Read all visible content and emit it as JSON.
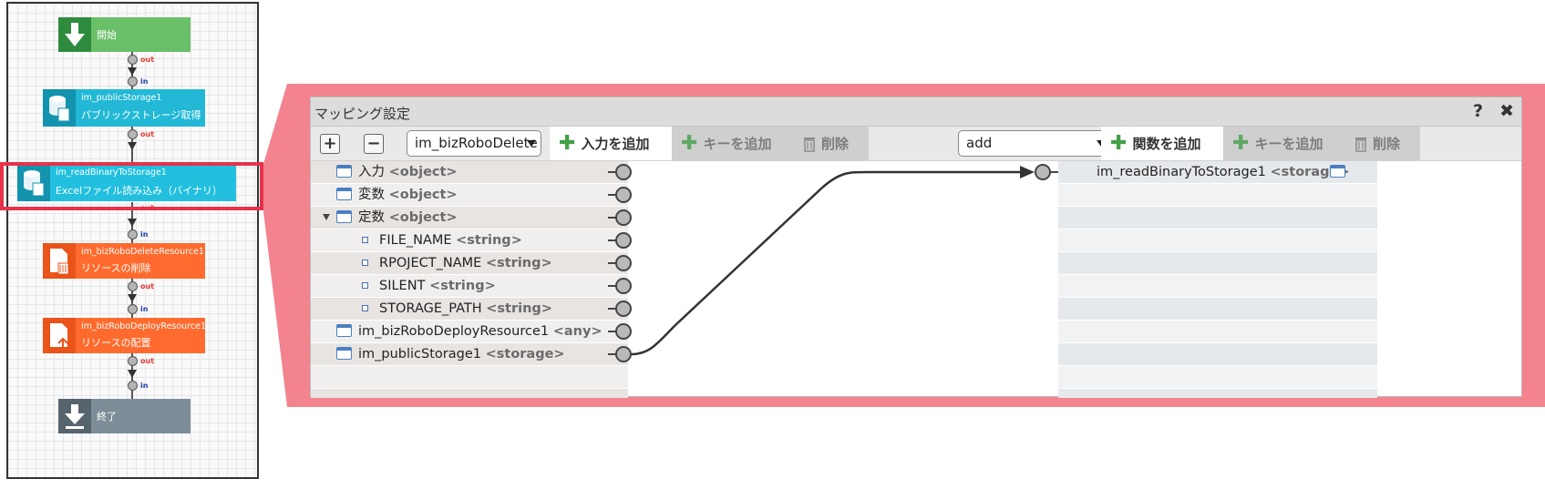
{
  "flow": {
    "start": {
      "label": "開始"
    },
    "nodes": [
      {
        "id": "im_publicStorage1",
        "label": "パブリックストレージ取得",
        "color": "#1fb6d4"
      },
      {
        "id": "im_readBinaryToStorage1",
        "label": "Excelファイル読み込み（バイナリ）",
        "color": "#1fb6d4"
      },
      {
        "id": "im_bizRoboDeleteResource1",
        "label": "リソースの削除",
        "color": "#ff6a2d"
      },
      {
        "id": "im_bizRoboDeployResource1",
        "label": "リソースの配置",
        "color": "#ff6a2d"
      }
    ],
    "end": {
      "label": "終了"
    },
    "port_out": "out",
    "port_in": "in"
  },
  "dialog": {
    "title": "マッピング設定",
    "help_label": "?",
    "close_label": "✖",
    "toolbar": {
      "expand_label": "+",
      "collapse_label": "−",
      "source_select_value": "im_bizRoboDelete",
      "add_input_label": "入力を追加",
      "add_key_left_label": "キーを追加",
      "delete_left_label": "削除",
      "function_select_value": "add",
      "add_function_label": "関数を追加",
      "add_key_right_label": "キーを追加",
      "delete_right_label": "削除"
    },
    "source_tree": [
      {
        "name": "入力",
        "type": "<object>"
      },
      {
        "name": "変数",
        "type": "<object>"
      },
      {
        "name": "定数",
        "type": "<object>"
      },
      {
        "name": "FILE_NAME",
        "type": "<string>"
      },
      {
        "name": "RPOJECT_NAME",
        "type": "<string>"
      },
      {
        "name": "SILENT",
        "type": "<string>"
      },
      {
        "name": "STORAGE_PATH",
        "type": "<string>"
      },
      {
        "name": "im_bizRoboDeployResource1",
        "type": "<any>"
      },
      {
        "name": "im_publicStorage1",
        "type": "<storage>"
      }
    ],
    "target_tree": [
      {
        "name": "im_readBinaryToStorage1",
        "type": "<storage>"
      }
    ],
    "mapping": {
      "from": "im_publicStorage1",
      "to": "im_readBinaryToStorage1"
    }
  }
}
